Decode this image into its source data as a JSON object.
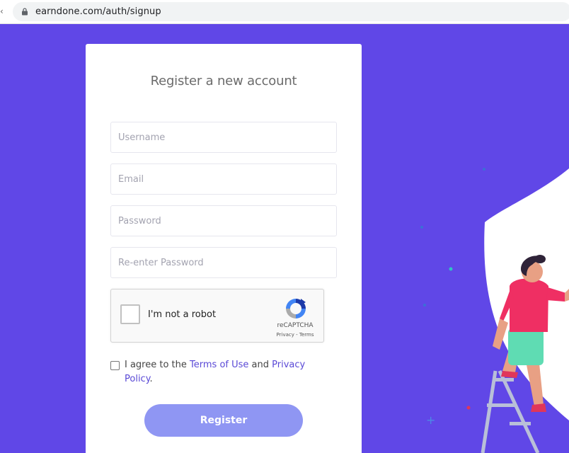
{
  "browser": {
    "url": "earndone.com/auth/signup"
  },
  "form": {
    "title": "Register a new account",
    "username_placeholder": "Username",
    "email_placeholder": "Email",
    "password_placeholder": "Password",
    "repassword_placeholder": "Re-enter Password",
    "captcha": {
      "label": "I'm not a robot",
      "brand": "reCAPTCHA",
      "links": "Privacy - Terms"
    },
    "terms": {
      "prefix": "I agree to the ",
      "terms_link": "Terms of Use",
      "middle": " and ",
      "privacy_link": "Privacy Policy",
      "suffix": "."
    },
    "register_label": "Register"
  },
  "colors": {
    "background": "#6047e7",
    "button": "#8f96f3",
    "link": "#5a49d6"
  }
}
